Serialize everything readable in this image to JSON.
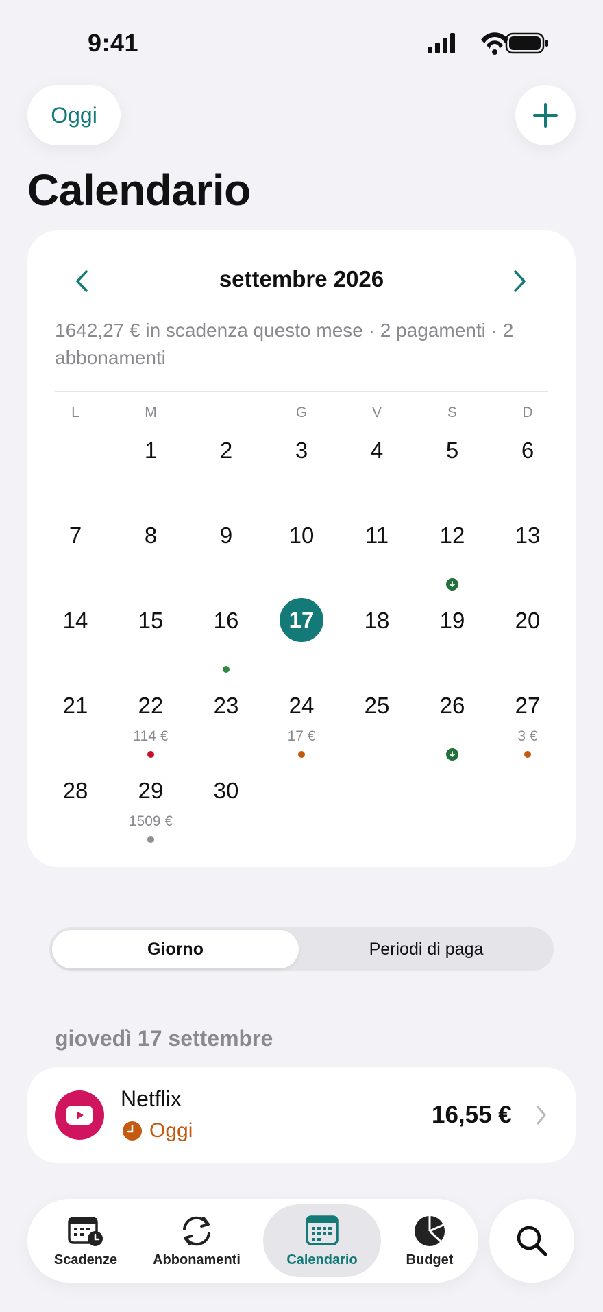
{
  "status_bar": {
    "time": "9:41"
  },
  "header": {
    "today_button": "Oggi",
    "title": "Calendario"
  },
  "calendar": {
    "month": "settembre 2026",
    "summary": "1642,27 € in scadenza questo mese · 2 pagamenti · 2 abbonamenti",
    "weekdays": [
      "L",
      "M",
      "",
      "G",
      "V",
      "S",
      "D"
    ],
    "today": "17",
    "accent_color": "#137a78",
    "rows": [
      [
        "",
        "1",
        "2",
        "3",
        "4",
        "5",
        "6"
      ],
      [
        "7",
        "8",
        "9",
        "10",
        "11",
        "12",
        "13"
      ],
      [
        "14",
        "15",
        "16",
        "17",
        "18",
        "19",
        "20"
      ],
      [
        "21",
        "22",
        "23",
        "24",
        "25",
        "26",
        "27"
      ],
      [
        "28",
        "29",
        "30",
        "",
        "",
        "",
        ""
      ]
    ],
    "markers": [
      {
        "day": "12",
        "amount": "",
        "kind": "income-arrow",
        "color": "#23703b"
      },
      {
        "day": "16",
        "amount": "",
        "kind": "dot",
        "color": "#2d8a3e"
      },
      {
        "day": "22",
        "amount": "114 €",
        "kind": "dot",
        "color": "#c8102e"
      },
      {
        "day": "24",
        "amount": "17 €",
        "kind": "dot",
        "color": "#c45a10"
      },
      {
        "day": "26",
        "amount": "",
        "kind": "income-arrow",
        "color": "#23703b"
      },
      {
        "day": "27",
        "amount": "3 €",
        "kind": "dot",
        "color": "#c45a10"
      },
      {
        "day": "29",
        "amount": "1509 €",
        "kind": "dot",
        "color": "#8e8e93"
      }
    ]
  },
  "segmented": {
    "active": "Giorno",
    "inactive": "Periodi di paga"
  },
  "day_section": {
    "date_label": "giovedì 17 settembre",
    "event": {
      "name": "Netflix",
      "status": "Oggi",
      "amount": "16,55 €",
      "logo_color": "#d0145e",
      "status_color": "#c45a10"
    }
  },
  "tab_bar": {
    "tabs": [
      {
        "label": "Scadenze",
        "icon": "calendar-clock-icon"
      },
      {
        "label": "Abbonamenti",
        "icon": "refresh-icon"
      },
      {
        "label": "Calendario",
        "icon": "calendar-grid-icon"
      },
      {
        "label": "Budget",
        "icon": "pie-chart-icon"
      }
    ],
    "active": "Calendario"
  }
}
